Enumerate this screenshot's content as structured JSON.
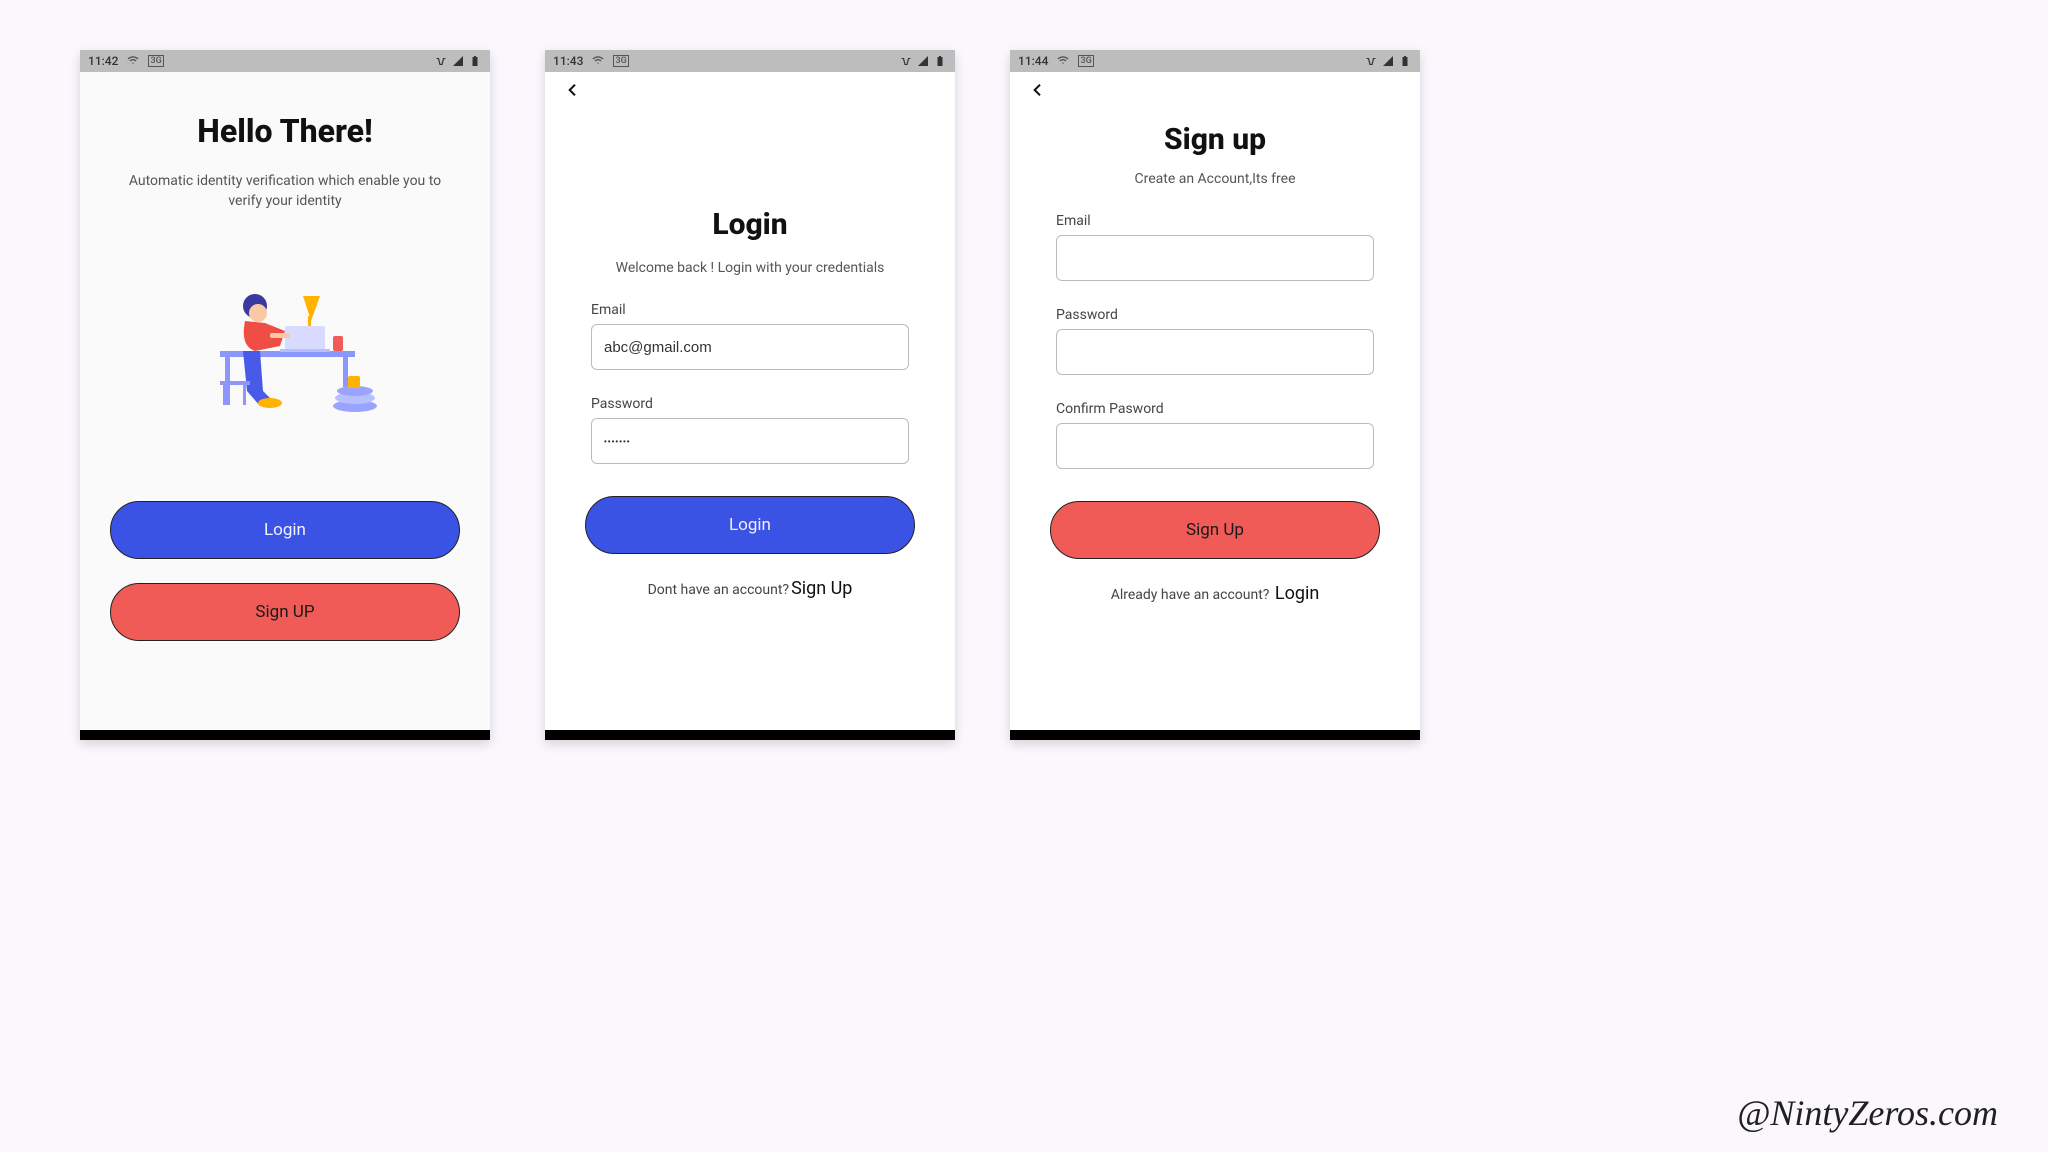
{
  "watermark": "@NintyZeros.com",
  "screens": {
    "welcome": {
      "status_time": "11:42",
      "title": "Hello There!",
      "subtitle": "Automatic identity verification which enable you to verify your identity",
      "login_label": "Login",
      "signup_label": "Sign UP"
    },
    "login": {
      "status_time": "11:43",
      "title": "Login",
      "subtitle": "Welcome back ! Login with your credentials",
      "email_label": "Email",
      "email_value": "abc@gmail.com",
      "password_label": "Password",
      "password_value": "•••••••",
      "submit_label": "Login",
      "footer_prompt": "Dont have an account?",
      "footer_link": "Sign Up"
    },
    "signup": {
      "status_time": "11:44",
      "title": "Sign up",
      "subtitle": "Create an Account,Its free",
      "email_label": "Email",
      "password_label": "Password",
      "confirm_label": "Confirm Pasword",
      "submit_label": "Sign Up",
      "footer_prompt": "Already have an account?",
      "footer_link": "Login"
    }
  },
  "colors": {
    "blue": "#3b53e5",
    "red": "#f05b57"
  }
}
